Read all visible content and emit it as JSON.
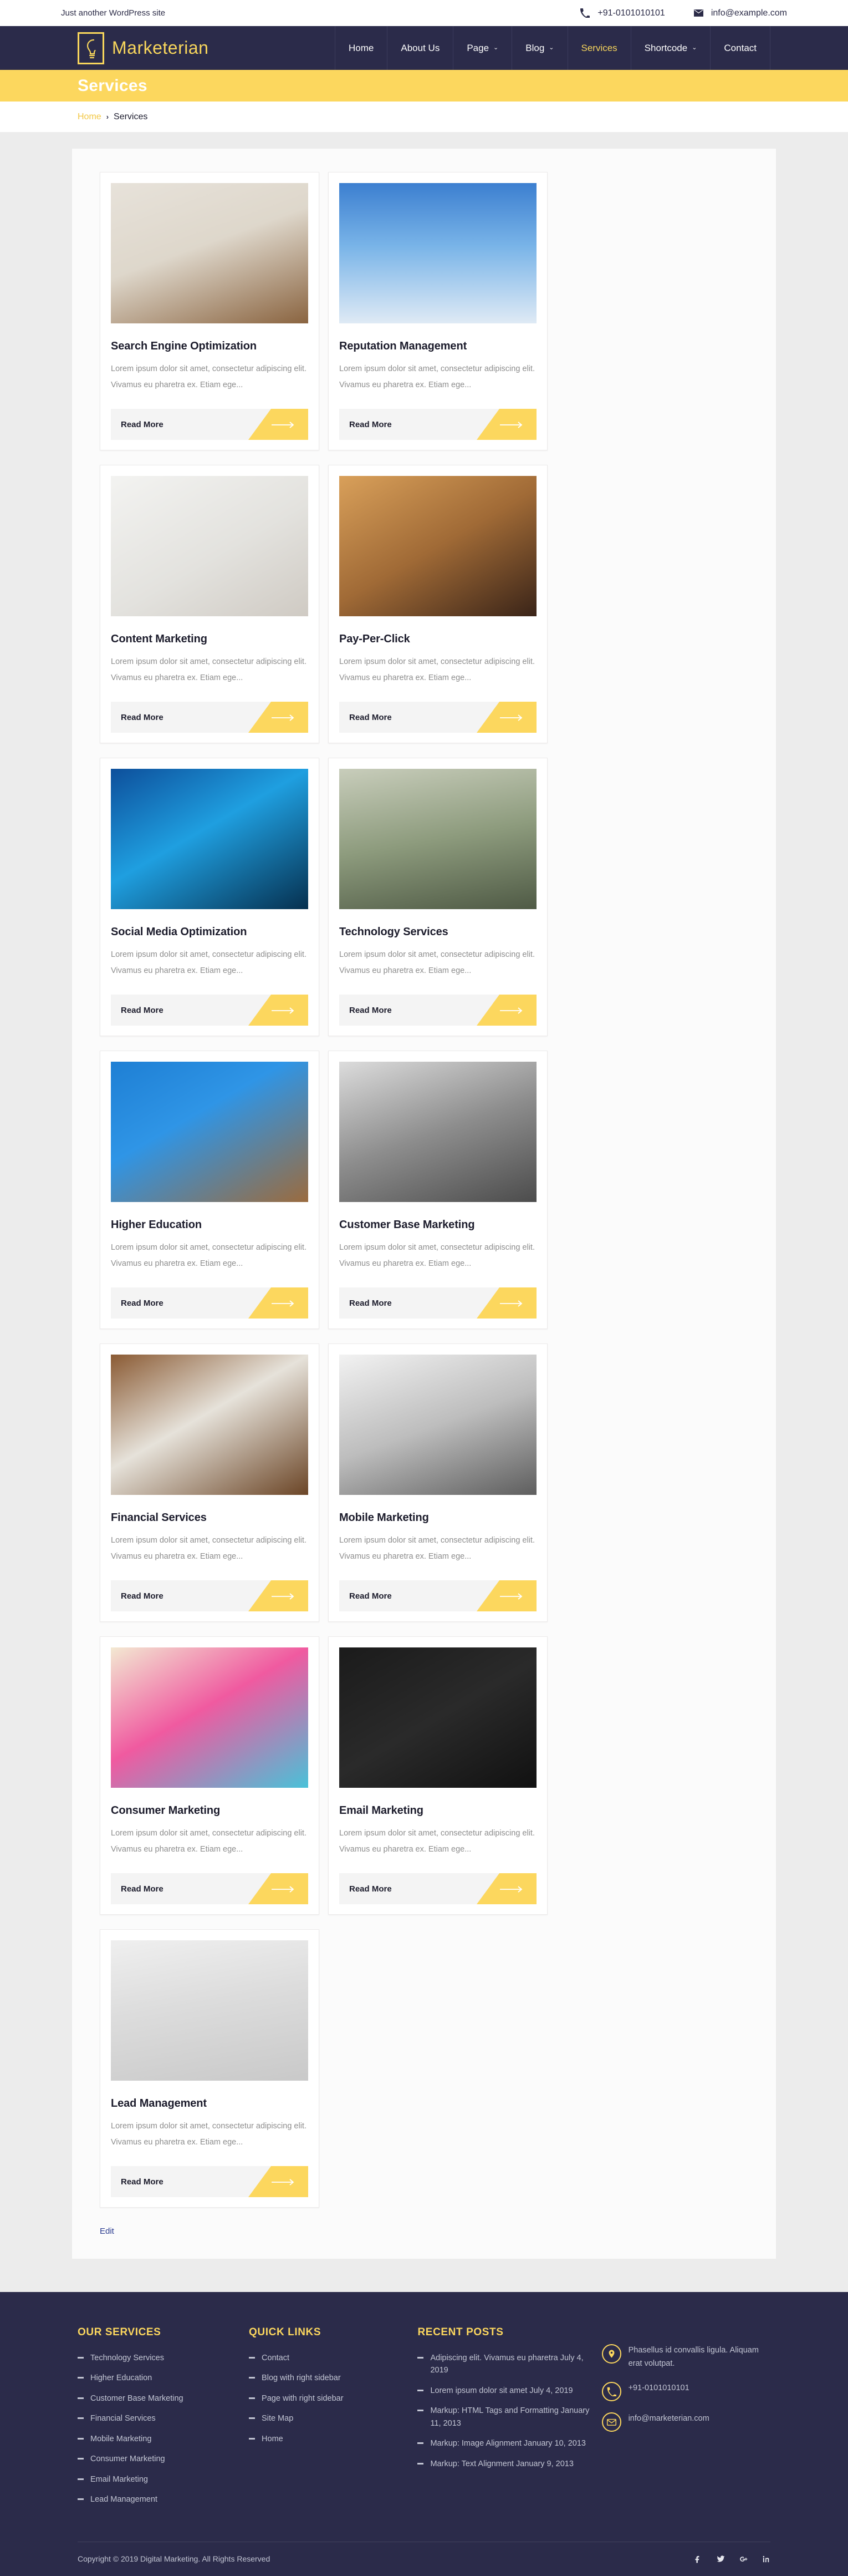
{
  "topbar": {
    "tagline": "Just another WordPress site",
    "phone": "+91-0101010101",
    "email": "info@example.com",
    "phone_icon": "phone-icon",
    "email_icon": "envelope-icon"
  },
  "header": {
    "logo_text": "Marketerian",
    "logo_icon": "lightbulb-head-icon",
    "nav": [
      {
        "label": "Home",
        "has_caret": false,
        "active": false
      },
      {
        "label": "About Us",
        "has_caret": false,
        "active": false
      },
      {
        "label": "Page",
        "has_caret": true,
        "active": false
      },
      {
        "label": "Blog",
        "has_caret": true,
        "active": false
      },
      {
        "label": "Services",
        "has_caret": false,
        "active": true
      },
      {
        "label": "Shortcode",
        "has_caret": true,
        "active": false
      },
      {
        "label": "Contact",
        "has_caret": false,
        "active": false
      }
    ],
    "caret_glyph": "⌄"
  },
  "banner": {
    "title": "Services",
    "bg": "#fcd75e"
  },
  "breadcrumb": {
    "home": "Home",
    "separator": "›",
    "current": "Services"
  },
  "services": {
    "excerpt": "Lorem ipsum dolor sit amet, consectetur adipiscing elit. Vivamus eu pharetra ex. Etiam ege...",
    "read_more": "Read More",
    "items": [
      {
        "title": "Search Engine Optimization",
        "image": "seo-sticky-notes-laptop"
      },
      {
        "title": "Reputation Management",
        "image": "marketing-strategy-signpost-sky"
      },
      {
        "title": "Content Marketing",
        "image": "content-marketing-desk-letters"
      },
      {
        "title": "Pay-Per-Click",
        "image": "smartphone-shopping-cart-hand"
      },
      {
        "title": "Social Media Optimization",
        "image": "social-icons-phones-fan"
      },
      {
        "title": "Technology Services",
        "image": "phone-railway-tracks-hand"
      },
      {
        "title": "Higher Education",
        "image": "books-math-formulas-blue"
      },
      {
        "title": "Customer Base Marketing",
        "image": "man-suit-red-alarm-clock"
      },
      {
        "title": "Financial Services",
        "image": "finance-paper-laptop-desk"
      },
      {
        "title": "Mobile Marketing",
        "image": "row-of-silver-smartphones"
      },
      {
        "title": "Consumer Marketing",
        "image": "colorful-newsletters-phone"
      },
      {
        "title": "Email Marketing",
        "image": "keyboard-social-media-keys"
      },
      {
        "title": "Lead Management",
        "image": "man-presenting-gear-lightbulb"
      }
    ]
  },
  "edit_link": "Edit",
  "footer": {
    "our_services": {
      "heading": "OUR SERVICES",
      "items": [
        "Technology Services",
        "Higher Education",
        "Customer Base Marketing",
        "Financial Services",
        "Mobile Marketing",
        "Consumer Marketing",
        "Email Marketing",
        "Lead Management"
      ]
    },
    "quick_links": {
      "heading": "QUICK LINKS",
      "items": [
        "Contact",
        "Blog with right sidebar",
        "Page with right sidebar",
        "Site Map",
        "Home"
      ]
    },
    "recent_posts": {
      "heading": "RECENT POSTS",
      "items": [
        "Adipiscing elit. Vivamus eu pharetra July 4, 2019",
        "Lorem ipsum dolor sit amet July 4, 2019",
        "Markup: HTML Tags and Formatting January 11, 2013",
        "Markup: Image Alignment January 10, 2013",
        "Markup: Text Alignment January 9, 2013"
      ]
    },
    "contact": [
      {
        "icon": "location-pin-icon",
        "text": "Phasellus id convallis ligula. Aliquam erat volutpat."
      },
      {
        "icon": "phone-icon",
        "text": "+91-0101010101"
      },
      {
        "icon": "envelope-icon",
        "text": "info@marketerian.com"
      }
    ],
    "copyright": "Copyright © 2019 Digital Marketing. All Rights Reserved",
    "socials": [
      {
        "name": "facebook-icon"
      },
      {
        "name": "twitter-icon"
      },
      {
        "name": "google-plus-icon"
      },
      {
        "name": "linkedin-icon"
      }
    ]
  }
}
